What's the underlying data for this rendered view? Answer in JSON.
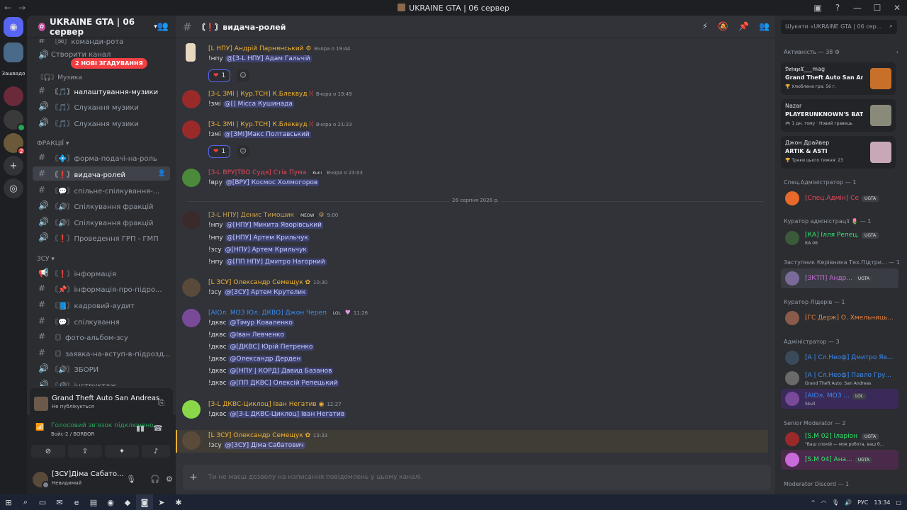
{
  "window": {
    "title": "UKRAINE GTA | 06 сервер"
  },
  "guilds": {
    "label_zashvadov": "Зашвадо"
  },
  "server": {
    "name": "UKRAINE GTA | 06 сервер",
    "mentions_pill": "2 НОВІ ЗГАДУВАННЯ"
  },
  "channels": {
    "top1": "〘✉〙команди-рота",
    "create": "Створити канал",
    "cat_music": "〘🎧〙Музика",
    "c1": "〘🎵〙налаштування-музики",
    "c2": "〘🎵〙Слухання музики",
    "c3": "〘🎵〙Слухання музики",
    "cat_fractions": "ФРАКЦІЇ",
    "c4": "〘💠〙форма-подачі-на-роль",
    "c5": "〘❗〙видача-ролей",
    "c6": "〘💬〙спільне-спілкування-...",
    "c7": "〘🔊〙Спілкування фракцій",
    "c8": "〘🔊〙Спілкування фракцій",
    "c9": "〘❗〙Проведення ГРП - ГМП",
    "cat_zsu": "ЗСУ",
    "c10": "〘❗〙інформація",
    "c11": "〘📌〙інформація-про-підро...",
    "c12": "〘📘〙кадровий-аудит",
    "c13": "〘💬〙спілкування",
    "c14": "〘〙фото-альбом-зсу",
    "c15": "〘〙заявка-на-вступ-в-підрозд...",
    "c16": "〘🔊〙ЗБОРИ",
    "c17": "〘🔊〙інструктаж"
  },
  "activity": {
    "game": "Grand Theft Auto San Andreas",
    "status": "Не публікується"
  },
  "voice": {
    "status": "Голосовий зв'язок підключено",
    "channel": "Войс-2 / BORBOR"
  },
  "user": {
    "name": "[ЗСУ]Діма Сабато...",
    "status": "Невидимий"
  },
  "chat": {
    "channel": "〘❗〙видача-ролей",
    "input_placeholder": "Ти не маєш дозволу на написання повідомлень у цьому каналі.",
    "day_divider": "26 серпня 2026 р.",
    "messages": [
      {
        "author": "[L НПУ] Андрій Парнянський",
        "time": "Вчора о 19:44",
        "lines": [
          {
            "cmd": "!нпу",
            "mention": "@[З-L НПУ] Адам Гальчій"
          }
        ],
        "react": "1"
      },
      {
        "author": "[З-L ЗМІ | Кур.ТСН] К.Блеквуд",
        "time": "Вчора о 19:49",
        "lines": [
          {
            "cmd": "!змі",
            "mention": "@[] Місса Кушинада"
          }
        ]
      },
      {
        "author": "[З-L ЗМІ | Кур.ТСН] К.Блеквуд",
        "time": "Вчора о 21:23",
        "lines": [
          {
            "cmd": "!змі",
            "mention": "@[ЗМІ]Макс Полтавський"
          }
        ],
        "react": "1"
      },
      {
        "author": "[З-L ВРУ|ТВО Судя] Стів Пума",
        "tag": "Kuni",
        "time": "Вчора о 23:03",
        "lines": [
          {
            "cmd": "!вру",
            "mention": "@[ВРУ] Космос Холмогоров"
          }
        ]
      },
      {
        "author": "[З-L НПУ] Денис Тимошик",
        "tag": "MEOW",
        "time": "9:00",
        "lines": [
          {
            "cmd": "!нпу",
            "mention": "@[НПУ] Микита Яворівський"
          },
          {
            "cmd": "!нпу",
            "mention": "@[НПУ] Артем Крильчук"
          },
          {
            "cmd": "!зсу",
            "mention": "@[НПУ] Артем Крильчук"
          },
          {
            "cmd": "!нпу",
            "mention": "@[ПП НПУ] Дмитро Нагорний"
          }
        ]
      },
      {
        "author": "[L ЗСУ] Олександр Семещук",
        "time": "10:30",
        "lines": [
          {
            "cmd": "!зсу",
            "mention": "@[ЗСУ] Артем Крутелик"
          }
        ]
      },
      {
        "author": "[AIОл. МОЗ Юл. ДКВО] Джон Череп",
        "tag": "LOL",
        "time": "11:26",
        "lines": [
          {
            "cmd": "!дквс",
            "mention": "@Тімур Коваленко"
          },
          {
            "cmd": "!дквс",
            "mention": "@Іван Левченко"
          },
          {
            "cmd": "!дквс",
            "mention": "@[ДКВС] Юрій Петренко"
          },
          {
            "cmd": "!дквс",
            "mention": "@Олександр Дерден"
          },
          {
            "cmd": "!дквс",
            "mention": "@[НПУ | КОРД] Давид Базанов"
          },
          {
            "cmd": "!дквс",
            "mention": "@[ПП ДКВС] Олексій Репецький"
          }
        ]
      },
      {
        "author": "[З-L ДКВС-Циклоц] Іван Негатив",
        "time": "12:27",
        "lines": [
          {
            "cmd": "!дквс",
            "mention": "@[З-L ДКВС-Циклоц] Іван Негатив"
          }
        ]
      },
      {
        "author": "[L ЗСУ] Олександр Семещук",
        "time": "13:33",
        "lines": [
          {
            "cmd": "!зсу",
            "mention": "@[ЗСУ] Діма Сабатович"
          }
        ]
      }
    ]
  },
  "members": {
    "search": "Шукати «UKRAINE GTA | 06 сер...",
    "activity_head": "Активність — 38",
    "cards": [
      {
        "name": "𝕯𝖊𝖋𝖚𝖟𝖊𝖃___mag",
        "game": "Grand Theft Auto San Andr...",
        "sub": "🏆 Улюблена гра: 56 г."
      },
      {
        "name": "Nazar",
        "game": "PLAYERUNKNOWN'S BAT...",
        "sub": "🎮 1 дн. тому · Новий гравець"
      },
      {
        "name": "Джон Драйвер",
        "game": "ARTIK & ASTI",
        "sub": "🏆 Треки цього тижня: 23"
      }
    ],
    "groups": [
      {
        "head": "Спец.Адміністратор — 1",
        "name": "[Спец.Адмін] Се...",
        "badge": "UGTA"
      },
      {
        "head": "Куратор адміністрації 🌷 — 1",
        "name": "[КА] Ілля Репец...",
        "badge": "UGTA",
        "sub": "КА 06"
      },
      {
        "head": "Заступник Керівника Тех.Підтри... — 1",
        "name": "[ЗКТП] Андр...",
        "badge": "UGTA"
      },
      {
        "head": "Куратор Лідерів — 1",
        "name": "[ГС Держ] О. Хмельниць..."
      },
      {
        "head": "Адміністратор — 3",
        "name": "[А | Сл.Неоф] Дмитро Яв..."
      },
      {
        "head": "",
        "name": "[А | Сл.Неоф] Павло Гру...",
        "sub": "Grand Theft Auto: San Andreas"
      },
      {
        "head": "",
        "name": "[AIОл. МОЗ ...",
        "badge": "LOL",
        "sub": "Skull"
      },
      {
        "head": "Senior Moderator — 2",
        "name": "[S.M 02] Іларіон ...",
        "badge": "UGTA",
        "sub": "\"Ваш спокій — моя робота, ваш б..."
      },
      {
        "head": "",
        "name": "[S.M 04] Ана...",
        "badge": "UGTA"
      },
      {
        "head": "Moderator Discord — 1",
        "name": ""
      }
    ]
  },
  "taskbar": {
    "lang": "РУС",
    "time": "13:34"
  },
  "colors": {
    "accent": "#5865f2",
    "red": "#f23f43",
    "green": "#23a55a",
    "gold": "#f0b232"
  }
}
